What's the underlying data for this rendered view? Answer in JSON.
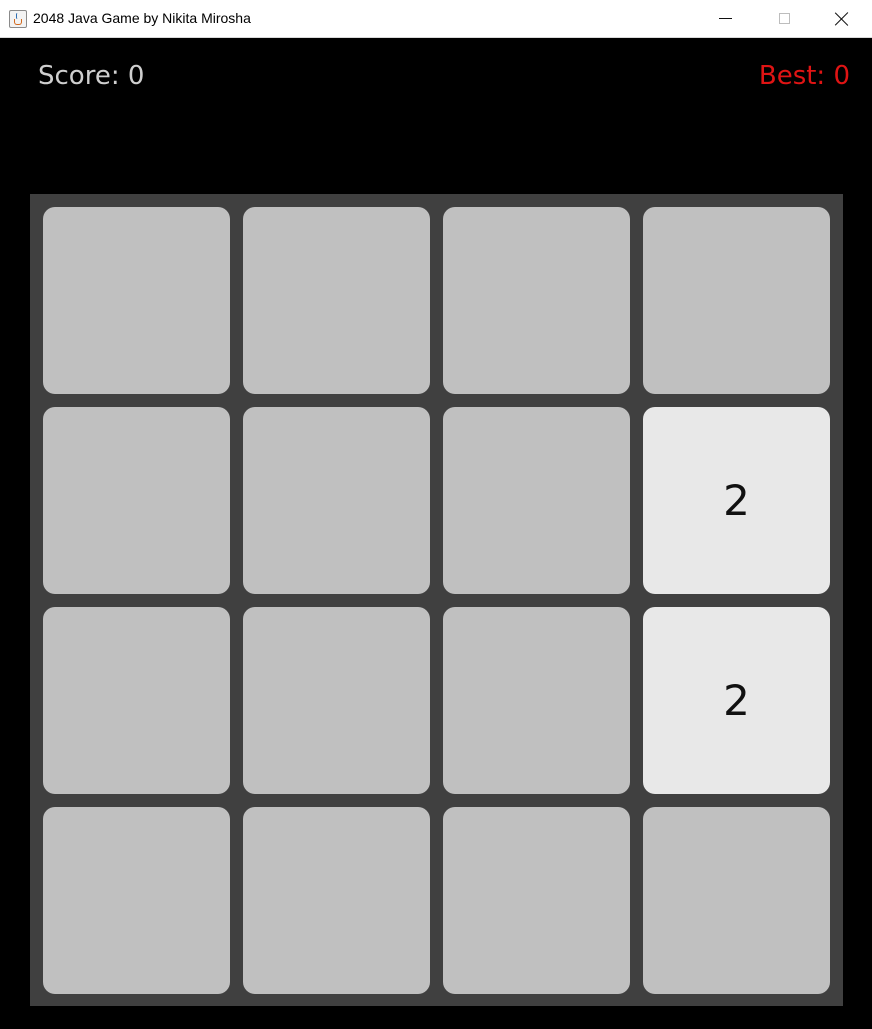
{
  "window": {
    "title": "2048 Java Game by Nikita Mirosha",
    "app_icon": "java-cup-icon",
    "controls": {
      "minimize_icon": "minimize-icon",
      "maximize_icon": "maximize-icon",
      "close_icon": "close-icon"
    }
  },
  "header": {
    "score_text": "Score: 0",
    "best_text": "Best: 0",
    "score_color": "#cfcfcf",
    "best_color": "#e01414"
  },
  "board": {
    "background_color": "#404040",
    "empty_tile_color": "#c0c0c0",
    "tile_2_color": "#e8e8e8",
    "rows": [
      [
        "",
        "",
        "",
        ""
      ],
      [
        "",
        "",
        "",
        "2"
      ],
      [
        "",
        "",
        "",
        "2"
      ],
      [
        "",
        "",
        "",
        ""
      ]
    ]
  }
}
